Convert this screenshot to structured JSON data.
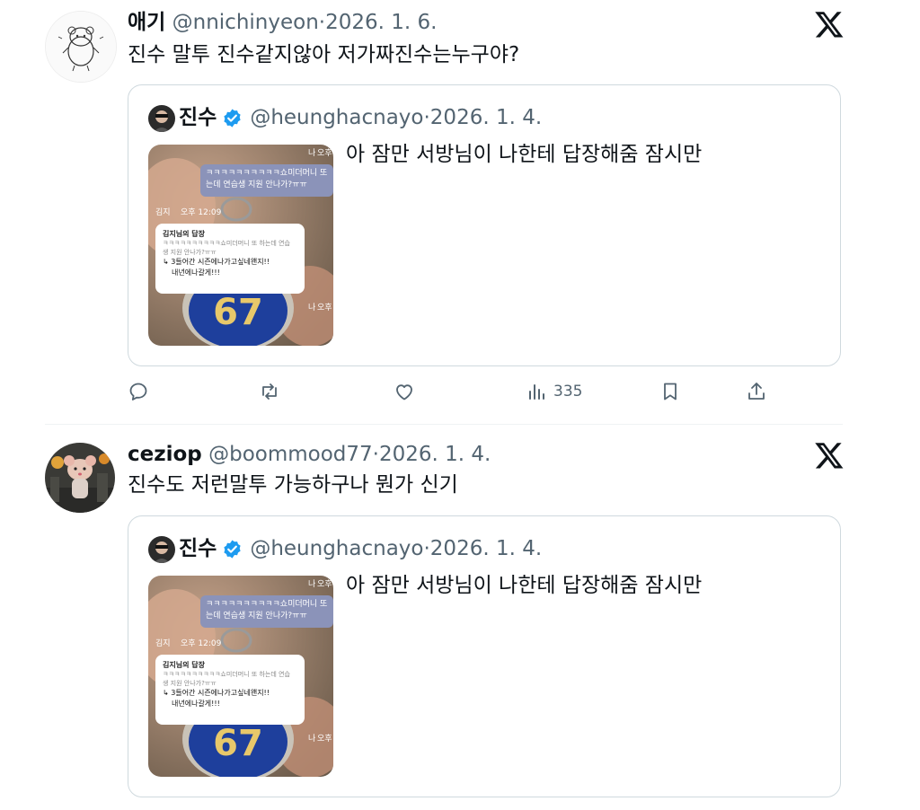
{
  "tweets": [
    {
      "display_name": "애기",
      "handle": "@nnichinyeon",
      "separator": "·",
      "date": "2026. 1. 6.",
      "text": "진수 말투 진수같지않아 저가짜진수는누구야?",
      "avatar_icon": "hamster-sketch-avatar",
      "quote": {
        "display_name": "진수",
        "handle": "@heunghacnayo",
        "separator": "·",
        "date": "2026. 1. 4.",
        "text": "아 잠만 서방님이 나한테 답장해줌 잠시만",
        "media": {
          "bubble_text_1": "ㅋㅋㅋㅋㅋㅋㅋㅋㅋㅋ쇼미더머니 또",
          "bubble_text_2": "는데 연습생 지원 안나가?ㅠㅠ",
          "sender_label": "김지",
          "sender_time": "오후 12:09",
          "card_title": "김지님의 답장",
          "card_quote_1": "ㅋㅋㅋㅋㅋㅋㅋㅋㅋㅋ쇼미더머니 또 하는데 연습",
          "card_quote_2": "생 지원 안나가?ㅠㅠ",
          "card_reply_1": "↳ 3들어간 시즌에나가고싶네왠지!!",
          "card_reply_2": "내년에나갈게!!!",
          "badge_number": "67",
          "me_label_1": "나",
          "me_label_2": "오후",
          "me_label_3": "나",
          "me_label_4": "오후"
        }
      },
      "actions": {
        "views": "335"
      }
    },
    {
      "display_name": "ceziop",
      "handle": "@boommood77",
      "separator": "·",
      "date": "2026. 1. 4.",
      "text": "진수도 저런말투 가능하구나 뭔가 신기",
      "avatar_icon": "rat-cityscape-avatar",
      "quote": {
        "display_name": "진수",
        "handle": "@heunghacnayo",
        "separator": "·",
        "date": "2026. 1. 4.",
        "text": "아 잠만 서방님이 나한테 답장해줌 잠시만",
        "media": {
          "bubble_text_1": "ㅋㅋㅋㅋㅋㅋㅋㅋㅋㅋ쇼미더머니 또",
          "bubble_text_2": "는데 연습생 지원 안나가?ㅠㅠ",
          "sender_label": "김지",
          "sender_time": "오후 12:09",
          "card_title": "김지님의 답장",
          "card_quote_1": "ㅋㅋㅋㅋㅋㅋㅋㅋㅋㅋ쇼미더머니 또 하는데 연습",
          "card_quote_2": "생 지원 안나가?ㅠㅠ",
          "card_reply_1": "↳ 3들어간 시즌에나가고싶네왠지!!",
          "card_reply_2": "내년에나갈게!!!",
          "badge_number": "67",
          "me_label_1": "나",
          "me_label_2": "오후",
          "me_label_3": "나",
          "me_label_4": "오후"
        }
      }
    }
  ],
  "colors": {
    "text": "#0f1419",
    "secondary": "#536471",
    "border": "#cfd9de",
    "verified": "#1d9bf0"
  },
  "icons": [
    "x-logo-icon",
    "verified-badge-icon",
    "reply-icon",
    "retweet-icon",
    "like-icon",
    "views-icon",
    "bookmark-icon",
    "share-icon"
  ]
}
